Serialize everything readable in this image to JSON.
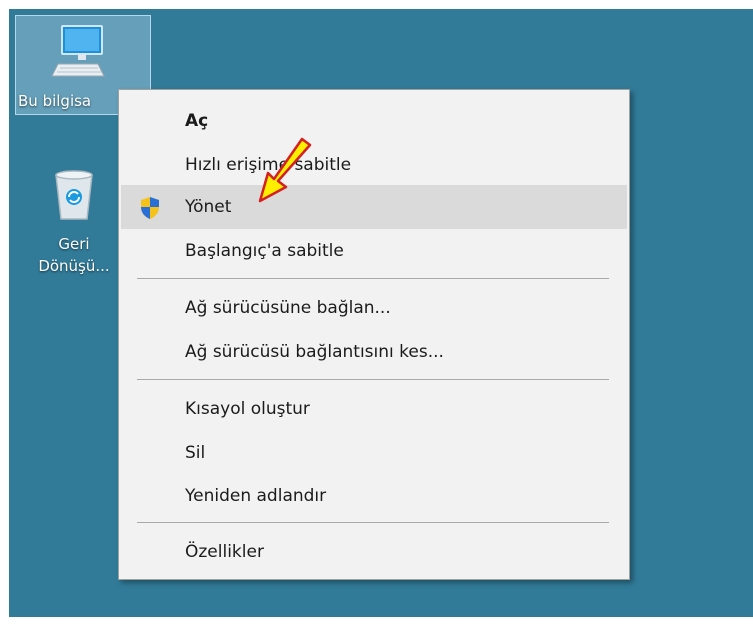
{
  "desktop": {
    "icons": [
      {
        "label": "Bu bilgisa"
      },
      {
        "label_line1": "Geri",
        "label_line2": "Dönüşü..."
      }
    ]
  },
  "context_menu": {
    "items": [
      {
        "label": "Aç",
        "bold": true
      },
      {
        "label": "Hızlı erişime sabitle"
      },
      {
        "label": "Yönet",
        "icon": "uac-shield-icon",
        "highlighted": true
      },
      {
        "label": "Başlangıç'a sabitle"
      },
      {
        "label": "Ağ sürücüsüne bağlan..."
      },
      {
        "label": "Ağ sürücüsü bağlantısını kes..."
      },
      {
        "label": "Kısayol oluştur"
      },
      {
        "label": "Sil"
      },
      {
        "label": "Yeniden adlandır"
      },
      {
        "label": "Özellikler"
      }
    ]
  },
  "annotation": {
    "icon": "yellow-arrow-icon",
    "color": "#ffee00"
  },
  "colors": {
    "desktop": "#317b99",
    "menu_bg": "#f2f2f2",
    "highlight": "#dadada"
  }
}
